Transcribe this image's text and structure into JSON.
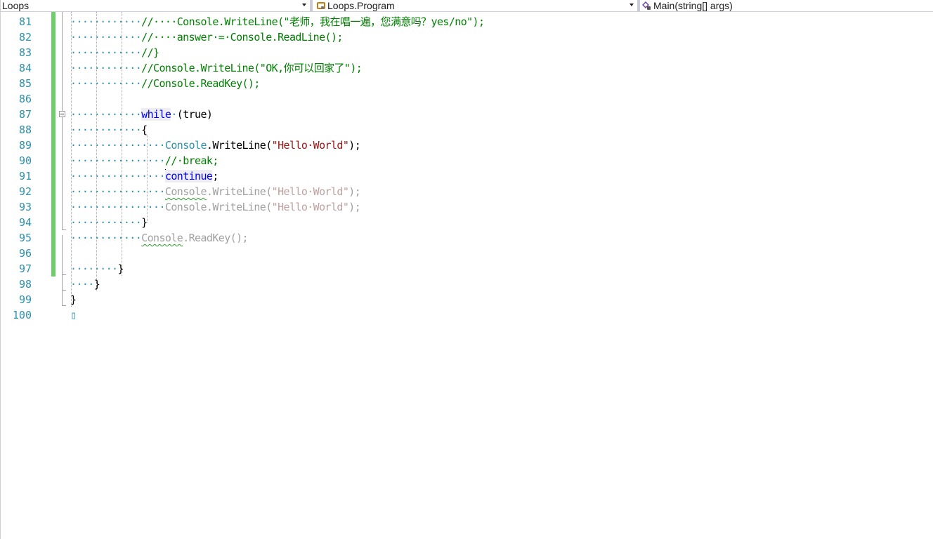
{
  "navbar": {
    "project": "Loops",
    "type": "Loops.Program",
    "member": "Main(string[] args)",
    "type_icon": "class-icon",
    "member_icon": "method-icon"
  },
  "editor": {
    "lines": [
      {
        "num": "81",
        "parts": [
          [
            "ws",
            "············"
          ],
          [
            "cm",
            "//····Console.WriteLine(\"老师，我在唱一遍，您满意吗？yes/no\");"
          ]
        ]
      },
      {
        "num": "82",
        "parts": [
          [
            "ws",
            "············"
          ],
          [
            "cm",
            "//····answer·=·Console.ReadLine();"
          ]
        ]
      },
      {
        "num": "83",
        "parts": [
          [
            "ws",
            "············"
          ],
          [
            "cm",
            "//}"
          ]
        ]
      },
      {
        "num": "84",
        "parts": [
          [
            "ws",
            "············"
          ],
          [
            "cm",
            "//Console.WriteLine(\"OK,你可以回家了\");"
          ]
        ]
      },
      {
        "num": "85",
        "parts": [
          [
            "ws",
            "············"
          ],
          [
            "cm",
            "//Console.ReadKey();"
          ]
        ]
      },
      {
        "num": "86",
        "parts": []
      },
      {
        "num": "87",
        "parts": [
          [
            "ws",
            "············"
          ],
          [
            "kw hl",
            "while"
          ],
          [
            "ws",
            "·"
          ],
          [
            "",
            "(true)"
          ]
        ]
      },
      {
        "num": "88",
        "parts": [
          [
            "ws",
            "············"
          ],
          [
            "",
            "{"
          ]
        ]
      },
      {
        "num": "89",
        "parts": [
          [
            "ws",
            "················"
          ],
          [
            "ty",
            "Console"
          ],
          [
            "",
            "."
          ],
          [
            "",
            "WriteLine("
          ],
          [
            "st",
            "\"Hello·World\""
          ],
          [
            "",
            ");"
          ]
        ]
      },
      {
        "num": "90",
        "parts": [
          [
            "ws",
            "················"
          ],
          [
            "cm",
            "//·break;"
          ]
        ]
      },
      {
        "num": "91",
        "parts": [
          [
            "ws",
            "················"
          ],
          [
            "caret",
            ""
          ],
          [
            "kw hl",
            "continue"
          ],
          [
            "",
            ";"
          ]
        ]
      },
      {
        "num": "92",
        "parts": [
          [
            "ws",
            "················"
          ],
          [
            "gray squiggle",
            "Console"
          ],
          [
            "gray",
            ".WriteLine("
          ],
          [
            "gray-st",
            "\"Hello·World\""
          ],
          [
            "gray",
            ");"
          ]
        ]
      },
      {
        "num": "93",
        "parts": [
          [
            "ws",
            "················"
          ],
          [
            "gray",
            "Console.WriteLine("
          ],
          [
            "gray-st",
            "\"Hello·World\""
          ],
          [
            "gray",
            ");"
          ]
        ]
      },
      {
        "num": "94",
        "parts": [
          [
            "ws",
            "············"
          ],
          [
            "",
            "}"
          ]
        ]
      },
      {
        "num": "95",
        "parts": [
          [
            "ws",
            "············"
          ],
          [
            "gray squiggle",
            "Console"
          ],
          [
            "gray",
            ".ReadKey();"
          ]
        ]
      },
      {
        "num": "96",
        "parts": []
      },
      {
        "num": "97",
        "parts": [
          [
            "ws",
            "········"
          ],
          [
            "",
            "}"
          ]
        ]
      },
      {
        "num": "98",
        "parts": [
          [
            "ws",
            "····"
          ],
          [
            "",
            "}"
          ]
        ]
      },
      {
        "num": "99",
        "parts": [
          [
            "",
            "}"
          ]
        ]
      },
      {
        "num": "100",
        "parts": [
          [
            "ws",
            "▯"
          ]
        ]
      }
    ]
  },
  "colors": {
    "line_number": "#2b91af",
    "comment": "#008000",
    "keyword": "#0000ff",
    "type": "#2b91af",
    "string": "#a31515",
    "change_bar": "#6ccf6a"
  }
}
